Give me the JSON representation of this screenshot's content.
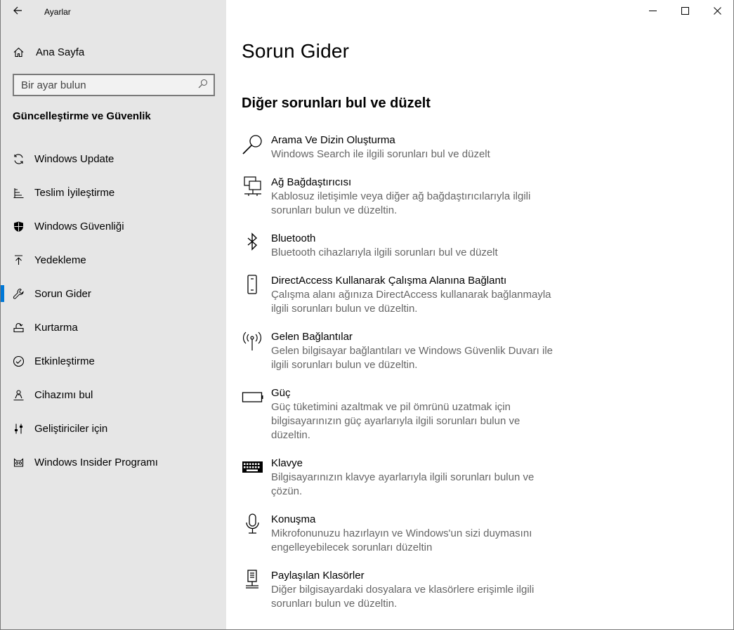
{
  "app": {
    "title": "Ayarlar"
  },
  "sidebar": {
    "home_label": "Ana Sayfa",
    "search_placeholder": "Bir ayar bulun",
    "section_heading": "Güncelleştirme ve Güvenlik",
    "items": [
      {
        "label": "Windows Update",
        "icon": "refresh-icon"
      },
      {
        "label": "Teslim İyileştirme",
        "icon": "delivery-optimization-icon"
      },
      {
        "label": "Windows Güvenliği",
        "icon": "shield-icon"
      },
      {
        "label": "Yedekleme",
        "icon": "backup-arrow-icon"
      },
      {
        "label": "Sorun Gider",
        "icon": "wrench-icon",
        "active": true
      },
      {
        "label": "Kurtarma",
        "icon": "recovery-icon"
      },
      {
        "label": "Etkinleştirme",
        "icon": "check-circle-icon"
      },
      {
        "label": "Cihazımı bul",
        "icon": "person-location-icon"
      },
      {
        "label": "Geliştiriciler için",
        "icon": "developer-sliders-icon"
      },
      {
        "label": "Windows Insider Programı",
        "icon": "insider-cat-icon"
      }
    ]
  },
  "main": {
    "title": "Sorun Gider",
    "section_title": "Diğer sorunları bul ve düzelt",
    "troubleshooters": [
      {
        "title": "Arama Ve Dizin Oluşturma",
        "desc": [
          "Windows Search ile ilgili sorunları bul ve düzelt"
        ],
        "icon": "search-icon"
      },
      {
        "title": "Ağ Bağdaştırıcısı",
        "desc": [
          "Kablosuz iletişimle veya diğer ağ bağdaştırıcılarıyla ilgili",
          "sorunları bulun ve düzeltin."
        ],
        "icon": "network-adapter-icon"
      },
      {
        "title": "Bluetooth",
        "desc": [
          "Bluetooth cihazlarıyla ilgili sorunları bul ve düzelt"
        ],
        "icon": "bluetooth-icon"
      },
      {
        "title": "DirectAccess Kullanarak Çalışma Alanına Bağlantı",
        "desc": [
          "Çalışma alanı ağınıza DirectAccess kullanarak bağlanmayla",
          "ilgili sorunları bulun ve düzeltin."
        ],
        "icon": "phone-device-icon"
      },
      {
        "title": "Gelen Bağlantılar",
        "desc": [
          "Gelen bilgisayar bağlantıları ve Windows Güvenlik Duvarı ile",
          "ilgili sorunları bulun ve düzeltin."
        ],
        "icon": "antenna-icon"
      },
      {
        "title": "Güç",
        "desc": [
          "Güç tüketimini azaltmak ve pil ömrünü uzatmak için",
          "bilgisayarınızın güç ayarlarıyla ilgili sorunları bulun ve",
          "düzeltin."
        ],
        "icon": "battery-icon"
      },
      {
        "title": "Klavye",
        "desc": [
          "Bilgisayarınızın klavye ayarlarıyla ilgili sorunları bulun ve",
          "çözün."
        ],
        "icon": "keyboard-icon"
      },
      {
        "title": "Konuşma",
        "desc": [
          "Mikrofonunuzu hazırlayın ve Windows'un sizi duymasını",
          "engelleyebilecek sorunları düzeltin"
        ],
        "icon": "microphone-icon"
      },
      {
        "title": "Paylaşılan Klasörler",
        "desc": [
          "Diğer bilgisayardaki dosyalara ve klasörlere erişimle ilgili",
          "sorunları bulun ve düzeltin."
        ],
        "icon": "shared-folder-icon"
      }
    ]
  },
  "colors": {
    "sidebar_bg": "#e6e6e6",
    "accent": "#0078d7",
    "desc_text": "#666666"
  }
}
